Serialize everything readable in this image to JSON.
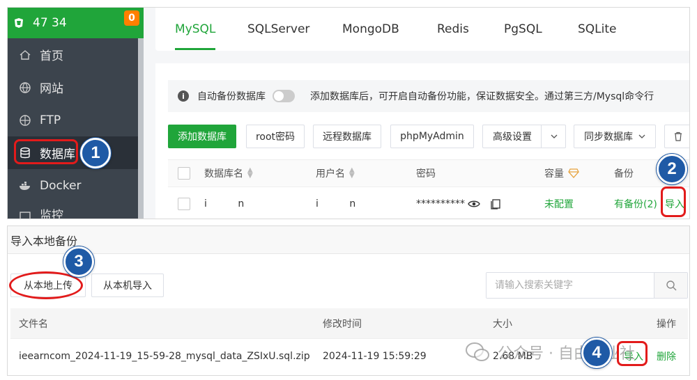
{
  "sidebar": {
    "brand_text": "47        34",
    "badge": "0",
    "items": [
      {
        "label": "首页",
        "icon": "home-icon"
      },
      {
        "label": "网站",
        "icon": "globe-icon"
      },
      {
        "label": "FTP",
        "icon": "ftp-globe-icon"
      },
      {
        "label": "数据库",
        "icon": "database-icon"
      },
      {
        "label": "Docker",
        "icon": "docker-icon"
      },
      {
        "label": "监控",
        "icon": "monitor-icon"
      }
    ]
  },
  "tabs": [
    {
      "label": "MySQL"
    },
    {
      "label": "SQLServer"
    },
    {
      "label": "MongoDB"
    },
    {
      "label": "Redis"
    },
    {
      "label": "PgSQL"
    },
    {
      "label": "SQLite"
    }
  ],
  "info_bar": {
    "toggle_label": "自动备份数据库",
    "message": "添加数据库后，可开启自动备份功能，保证数据安全。通过第三方/Mysql命令行"
  },
  "toolbar": {
    "add_db": "添加数据库",
    "root_pwd": "root密码",
    "remote_db": "远程数据库",
    "phpmyadmin": "phpMyAdmin",
    "advanced": "高级设置",
    "sync_db": "同步数据库"
  },
  "db_table": {
    "headers": {
      "name": "数据库名",
      "user": "用户名",
      "password": "密码",
      "capacity": "容量",
      "backup": "备份"
    },
    "row": {
      "name": "i          n",
      "user": "i          n",
      "password": "**********",
      "capacity": "未配置",
      "backup": "有备份(2)",
      "import": "导入"
    }
  },
  "dialog": {
    "title": "导入本地备份",
    "upload_btn": "从本地上传",
    "local_import_btn": "从本机导入",
    "search_placeholder": "请输入搜索关键字",
    "headers": {
      "file": "文件名",
      "mtime": "修改时间",
      "size": "大小",
      "action": "操作"
    },
    "row": {
      "file": "ieearncom_2024-11-19_15-59-28_mysql_data_ZSIxU.sql.zip",
      "mtime": "2024-11-19 15:59:29",
      "size": "2.68 MB",
      "import": "导入",
      "delete": "删除"
    }
  },
  "steps": [
    "1",
    "2",
    "3",
    "4"
  ],
  "watermark": "公众号 · 自由职业社",
  "colors": {
    "accent": "#20a53a",
    "sidebar": "#3c444d",
    "badge": "#ff7f00",
    "highlight": "#e21b1b",
    "step": "#1f5aa6"
  }
}
